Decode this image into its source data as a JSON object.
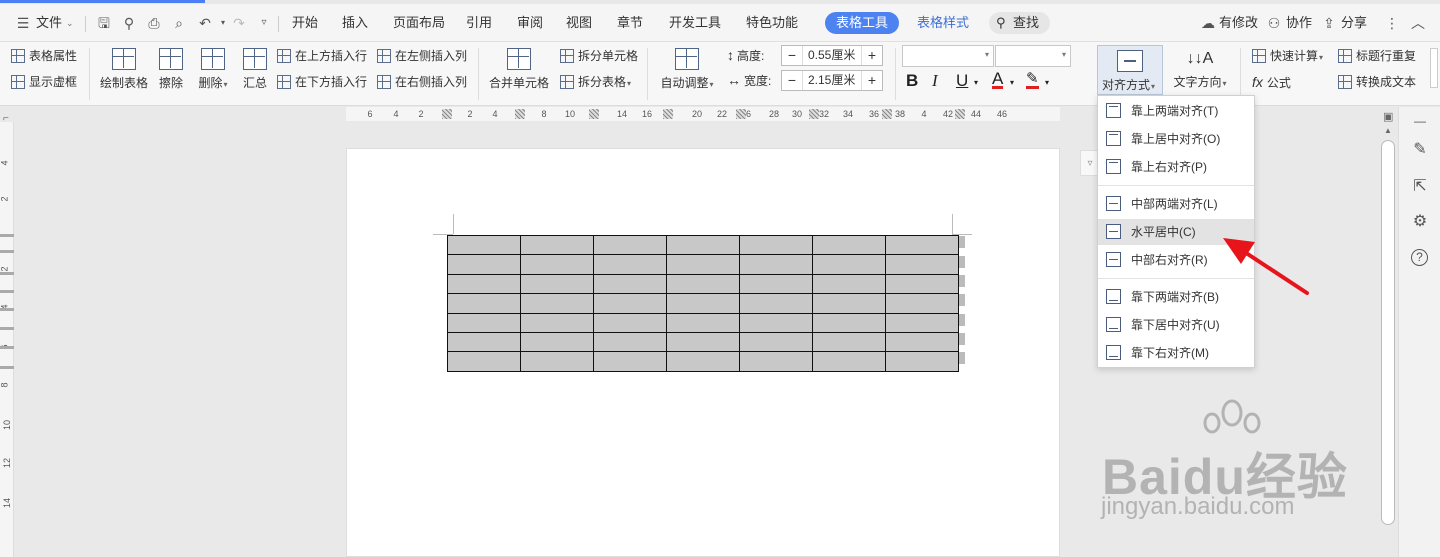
{
  "menubar": {
    "file_label": "文件",
    "tabs": [
      "开始",
      "插入",
      "页面布局",
      "引用",
      "审阅",
      "视图",
      "章节",
      "开发工具",
      "特色功能"
    ],
    "active_tab": "表格工具",
    "table_style_tab": "表格样式",
    "search_label": "查找",
    "changes_label": "有修改",
    "collab_label": "协作",
    "share_label": "分享"
  },
  "ribbon": {
    "table_props": "表格属性",
    "show_grid": "显示虚框",
    "draw_table": "绘制表格",
    "erase": "擦除",
    "delete": "删除",
    "summary": "汇总",
    "insert_row_above": "在上方插入行",
    "insert_row_below": "在下方插入行",
    "insert_col_left": "在左侧插入列",
    "insert_col_right": "在右侧插入列",
    "merge_cells": "合并单元格",
    "split_cells": "拆分单元格",
    "split_table": "拆分表格",
    "auto_fit": "自动调整",
    "height_label": "高度:",
    "height_value": "0.55厘米",
    "width_label": "宽度:",
    "width_value": "2.15厘米",
    "align_label": "对齐方式",
    "text_direction": "文字方向",
    "quick_calc": "快速计算",
    "formula": "公式",
    "header_repeat": "标题行重复",
    "to_text": "转换成文本"
  },
  "ruler": {
    "ticks": [
      "6",
      "4",
      "2",
      "2",
      "4",
      "8",
      "10",
      "14",
      "16",
      "8",
      "20",
      "22",
      "26",
      "28",
      "30",
      "32",
      "34",
      "36",
      "38",
      "4",
      "42",
      "44",
      "46"
    ],
    "vticks": [
      "4",
      "2",
      "2",
      "4",
      "6",
      "8",
      "10",
      "12",
      "14"
    ]
  },
  "align_menu": {
    "items": [
      {
        "label": "靠上两端对齐(T)",
        "pos": "top"
      },
      {
        "label": "靠上居中对齐(O)",
        "pos": "top"
      },
      {
        "label": "靠上右对齐(P)",
        "pos": "top"
      },
      {
        "label": "中部两端对齐(L)",
        "pos": "mid"
      },
      {
        "label": "水平居中(C)",
        "pos": "mid"
      },
      {
        "label": "中部右对齐(R)",
        "pos": "mid"
      },
      {
        "label": "靠下两端对齐(B)",
        "pos": "bot"
      },
      {
        "label": "靠下居中对齐(U)",
        "pos": "bot"
      },
      {
        "label": "靠下右对齐(M)",
        "pos": "bot"
      }
    ],
    "selected": "水平居中(C)"
  },
  "table": {
    "rows": 7,
    "cols": 7,
    "cell_color": "#c8c8c8"
  },
  "watermark": {
    "brand": "Baidu经验",
    "url": "jingyan.baidu.com"
  },
  "colors": {
    "accent": "#4c83f0",
    "arrow": "#e8141c"
  }
}
